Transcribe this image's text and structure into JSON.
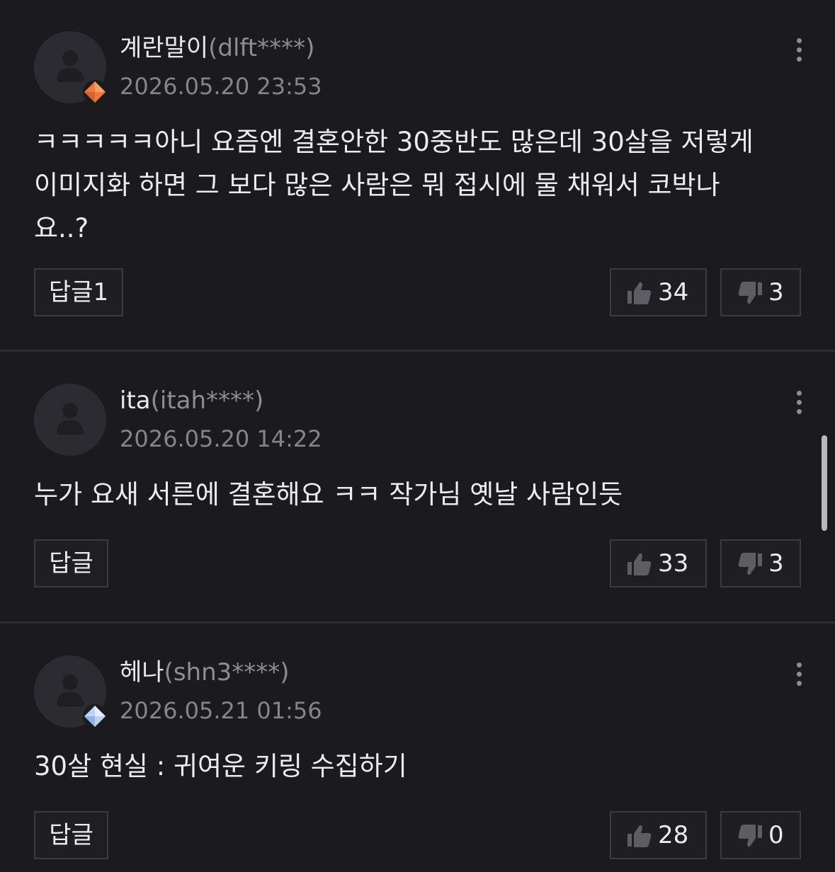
{
  "comments": [
    {
      "nickname": "계란말이",
      "user_id": "(dlft****)",
      "date": "2026.05.20 23:53",
      "text": "ㅋㅋㅋㅋㅋ아니 요즘엔 결혼안한 30중반도 많은데 30살을 저렇게\n이미지화 하면 그 보다 많은 사람은 뭐 접시에 물 채워서 코박나\n요..?",
      "reply_label": "답글1",
      "likes": "34",
      "dislikes": "3",
      "badge_icon": "orange-diamond-badge-icon",
      "badge_color": "#f07a35"
    },
    {
      "nickname": "ita",
      "user_id": "(itah****)",
      "date": "2026.05.20 14:22",
      "text": "누가 요새 서른에 결혼해요 ㅋㅋ 작가님 옛날 사람인듯",
      "reply_label": "답글",
      "likes": "33",
      "dislikes": "3"
    },
    {
      "nickname": "헤나",
      "user_id": "(shn3****)",
      "date": "2026.05.21 01:56",
      "text": "30살 현실 : 귀여운 키링 수집하기",
      "reply_label": "답글",
      "likes": "28",
      "dislikes": "0",
      "badge_icon": "crystal-diamond-badge-icon",
      "badge_color": "#b8d4f5"
    }
  ],
  "colors": {
    "background": "#1b1a1f",
    "text_primary": "#ececef",
    "text_secondary": "#85848a",
    "button_border": "#3c3b41"
  },
  "icons": [
    "user-avatar-icon",
    "more-vertical-icon",
    "thumbs-up-icon",
    "thumbs-down-icon"
  ]
}
